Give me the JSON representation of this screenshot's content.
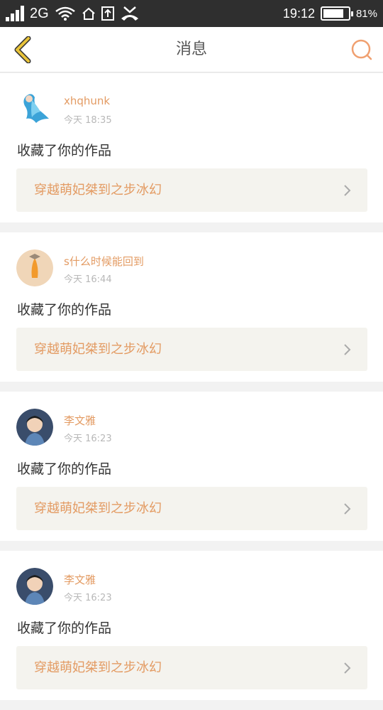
{
  "status_bar": {
    "network": "2G",
    "time": "19:12",
    "battery_percent": "81%",
    "battery_level": 0.81
  },
  "header": {
    "title": "消息"
  },
  "messages": [
    {
      "user": "xhqhunk",
      "time": "今天 18:35",
      "action": "收藏了你的作品",
      "work_title": "穿越萌妃桀到之步冰幻"
    },
    {
      "user": "s什么时候能回到",
      "time": "今天 16:44",
      "action": "收藏了你的作品",
      "work_title": "穿越萌妃桀到之步冰幻"
    },
    {
      "user": "李文雅",
      "time": "今天 16:23",
      "action": "收藏了你的作品",
      "work_title": "穿越萌妃桀到之步冰幻"
    },
    {
      "user": "李文雅",
      "time": "今天 16:23",
      "action": "收藏了你的作品",
      "work_title": "穿越萌妃桀到之步冰幻"
    }
  ],
  "colors": {
    "accent": "#e39b63",
    "status_bar": "#2f2f2f",
    "card_link_bg": "#f4f3ee",
    "back_icon": "#e8c33a"
  }
}
